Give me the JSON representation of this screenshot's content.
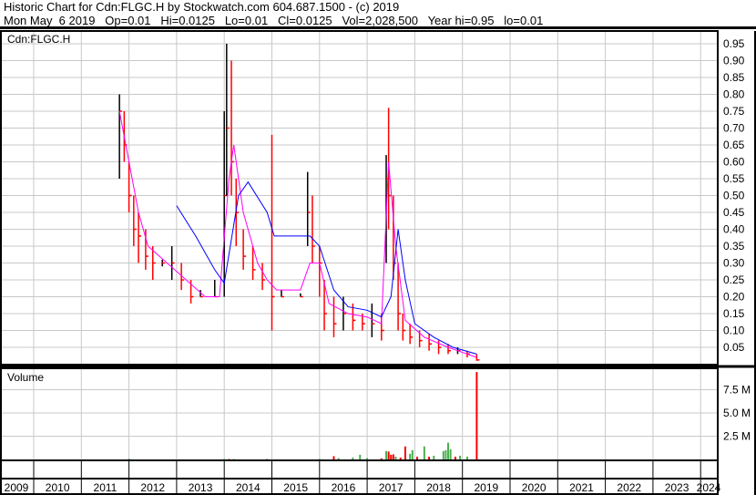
{
  "header": {
    "line1": "Historic Chart for Cdn:FLGC.H by Stockwatch.com 604.687.1500 - (c) 2019",
    "line2": "Mon May  6 2019   Op=0.01   Hi=0.0125   Lo=0.01   Cl=0.0125   Vol=2,028,500   Year hi=0.95   lo=0.01"
  },
  "colors": {
    "up": "#000000",
    "down": "#ff0000",
    "ma_short": "#ff00ff",
    "ma_long": "#0000ff",
    "vol_up": "#4caf50",
    "vol_down": "#ff0000",
    "grid": "#c8c8c8"
  },
  "chart_data": [
    {
      "type": "line",
      "title": "Cdn:FLGC.H",
      "ylim": [
        0,
        0.975
      ],
      "yticks": [
        "0.05",
        "0.10",
        "0.15",
        "0.20",
        "0.25",
        "0.30",
        "0.35",
        "0.40",
        "0.45",
        "0.50",
        "0.55",
        "0.60",
        "0.65",
        "0.70",
        "0.75",
        "0.80",
        "0.85",
        "0.90",
        "0.95"
      ],
      "xticks": [
        "2009",
        "2010",
        "2011",
        "2012",
        "2013",
        "2014",
        "2015",
        "2016",
        "2017",
        "2018",
        "2019",
        "2020",
        "2021",
        "2022",
        "2023",
        "2024"
      ],
      "price": [
        [
          2011.8,
          0.8,
          0.55,
          0.75
        ],
        [
          2011.9,
          0.75,
          0.6,
          0.65
        ],
        [
          2012.0,
          0.6,
          0.45,
          0.5
        ],
        [
          2012.1,
          0.5,
          0.35,
          0.4
        ],
        [
          2012.2,
          0.45,
          0.3,
          0.38
        ],
        [
          2012.35,
          0.4,
          0.28,
          0.32
        ],
        [
          2012.5,
          0.35,
          0.25,
          0.3
        ],
        [
          2012.7,
          0.31,
          0.29,
          0.3
        ],
        [
          2012.9,
          0.35,
          0.25,
          0.3
        ],
        [
          2013.1,
          0.3,
          0.22,
          0.25
        ],
        [
          2013.3,
          0.25,
          0.18,
          0.2
        ],
        [
          2013.5,
          0.22,
          0.2,
          0.2
        ],
        [
          2013.8,
          0.25,
          0.2,
          0.2
        ],
        [
          2014.0,
          0.75,
          0.2,
          0.5
        ],
        [
          2014.05,
          0.95,
          0.5,
          0.7
        ],
        [
          2014.15,
          0.9,
          0.5,
          0.6
        ],
        [
          2014.25,
          0.55,
          0.35,
          0.45
        ],
        [
          2014.4,
          0.4,
          0.28,
          0.32
        ],
        [
          2014.6,
          0.35,
          0.25,
          0.28
        ],
        [
          2014.8,
          0.3,
          0.22,
          0.25
        ],
        [
          2015.0,
          0.68,
          0.1,
          0.2
        ],
        [
          2015.2,
          0.22,
          0.2,
          0.2
        ],
        [
          2015.6,
          0.21,
          0.2,
          0.2
        ],
        [
          2015.75,
          0.57,
          0.35,
          0.45
        ],
        [
          2015.85,
          0.5,
          0.3,
          0.35
        ],
        [
          2016.0,
          0.35,
          0.2,
          0.3
        ],
        [
          2016.1,
          0.25,
          0.1,
          0.15
        ],
        [
          2016.3,
          0.2,
          0.08,
          0.12
        ],
        [
          2016.5,
          0.2,
          0.1,
          0.15
        ],
        [
          2016.7,
          0.18,
          0.1,
          0.13
        ],
        [
          2016.9,
          0.15,
          0.1,
          0.12
        ],
        [
          2017.1,
          0.18,
          0.08,
          0.12
        ],
        [
          2017.3,
          0.15,
          0.07,
          0.1
        ],
        [
          2017.4,
          0.62,
          0.3,
          0.55
        ],
        [
          2017.45,
          0.76,
          0.4,
          0.5
        ],
        [
          2017.55,
          0.5,
          0.25,
          0.3
        ],
        [
          2017.65,
          0.3,
          0.1,
          0.15
        ],
        [
          2017.75,
          0.15,
          0.07,
          0.1
        ],
        [
          2017.9,
          0.12,
          0.06,
          0.08
        ],
        [
          2018.1,
          0.1,
          0.05,
          0.07
        ],
        [
          2018.3,
          0.09,
          0.04,
          0.06
        ],
        [
          2018.5,
          0.07,
          0.03,
          0.05
        ],
        [
          2018.7,
          0.06,
          0.03,
          0.04
        ],
        [
          2018.9,
          0.05,
          0.03,
          0.04
        ],
        [
          2019.1,
          0.04,
          0.02,
          0.03
        ],
        [
          2019.3,
          0.03,
          0.01,
          0.0125
        ]
      ],
      "ma_short": [
        [
          2011.8,
          0.75
        ],
        [
          2012.0,
          0.6
        ],
        [
          2012.2,
          0.45
        ],
        [
          2012.4,
          0.35
        ],
        [
          2012.8,
          0.3
        ],
        [
          2013.2,
          0.25
        ],
        [
          2013.6,
          0.2
        ],
        [
          2013.9,
          0.2
        ],
        [
          2014.1,
          0.55
        ],
        [
          2014.2,
          0.65
        ],
        [
          2014.4,
          0.45
        ],
        [
          2014.7,
          0.3
        ],
        [
          2014.9,
          0.25
        ],
        [
          2015.1,
          0.22
        ],
        [
          2015.6,
          0.22
        ],
        [
          2015.8,
          0.3
        ],
        [
          2016.0,
          0.3
        ],
        [
          2016.2,
          0.18
        ],
        [
          2016.6,
          0.15
        ],
        [
          2017.0,
          0.14
        ],
        [
          2017.3,
          0.12
        ],
        [
          2017.45,
          0.6
        ],
        [
          2017.6,
          0.35
        ],
        [
          2017.8,
          0.13
        ],
        [
          2018.2,
          0.08
        ],
        [
          2018.7,
          0.05
        ],
        [
          2019.3,
          0.02
        ]
      ],
      "ma_long": [
        [
          2013.0,
          0.47
        ],
        [
          2013.4,
          0.38
        ],
        [
          2013.8,
          0.28
        ],
        [
          2014.0,
          0.24
        ],
        [
          2014.3,
          0.5
        ],
        [
          2014.5,
          0.54
        ],
        [
          2014.9,
          0.45
        ],
        [
          2015.05,
          0.38
        ],
        [
          2015.8,
          0.38
        ],
        [
          2016.0,
          0.35
        ],
        [
          2016.3,
          0.22
        ],
        [
          2016.6,
          0.17
        ],
        [
          2017.0,
          0.16
        ],
        [
          2017.3,
          0.14
        ],
        [
          2017.5,
          0.2
        ],
        [
          2017.65,
          0.4
        ],
        [
          2017.8,
          0.25
        ],
        [
          2018.0,
          0.12
        ],
        [
          2018.4,
          0.08
        ],
        [
          2018.8,
          0.05
        ],
        [
          2019.3,
          0.03
        ]
      ]
    },
    {
      "type": "bar",
      "title": "Volume",
      "ylim": [
        0,
        10
      ],
      "unit": "M",
      "yticks": [
        "2.5 M",
        "5.0 M",
        "7.5 M"
      ],
      "bars": [
        [
          2012.0,
          0.08,
          "up"
        ],
        [
          2014.0,
          0.06,
          "up"
        ],
        [
          2014.1,
          0.05,
          "down"
        ],
        [
          2014.2,
          0.05,
          "up"
        ],
        [
          2014.9,
          0.06,
          "up"
        ],
        [
          2016.0,
          0.06,
          "up"
        ],
        [
          2016.3,
          0.35,
          "down"
        ],
        [
          2016.4,
          0.15,
          "up"
        ],
        [
          2016.7,
          0.2,
          "up"
        ],
        [
          2016.85,
          0.5,
          "up"
        ],
        [
          2017.0,
          0.15,
          "up"
        ],
        [
          2017.3,
          0.12,
          "down"
        ],
        [
          2017.4,
          0.9,
          "up"
        ],
        [
          2017.45,
          0.85,
          "down"
        ],
        [
          2017.5,
          0.5,
          "down"
        ],
        [
          2017.55,
          0.55,
          "down"
        ],
        [
          2017.6,
          0.3,
          "up"
        ],
        [
          2017.7,
          0.2,
          "down"
        ],
        [
          2017.8,
          1.4,
          "down"
        ],
        [
          2017.9,
          0.6,
          "up"
        ],
        [
          2017.95,
          1.0,
          "up"
        ],
        [
          2018.05,
          0.3,
          "down"
        ],
        [
          2018.2,
          1.4,
          "up"
        ],
        [
          2018.3,
          0.3,
          "down"
        ],
        [
          2018.4,
          0.4,
          "up"
        ],
        [
          2018.6,
          0.9,
          "up"
        ],
        [
          2018.65,
          1.0,
          "up"
        ],
        [
          2018.7,
          1.8,
          "up"
        ],
        [
          2018.75,
          1.1,
          "up"
        ],
        [
          2018.85,
          0.3,
          "down"
        ],
        [
          2018.95,
          0.4,
          "up"
        ],
        [
          2019.1,
          0.3,
          "up"
        ],
        [
          2019.3,
          9.4,
          "down"
        ]
      ]
    }
  ]
}
